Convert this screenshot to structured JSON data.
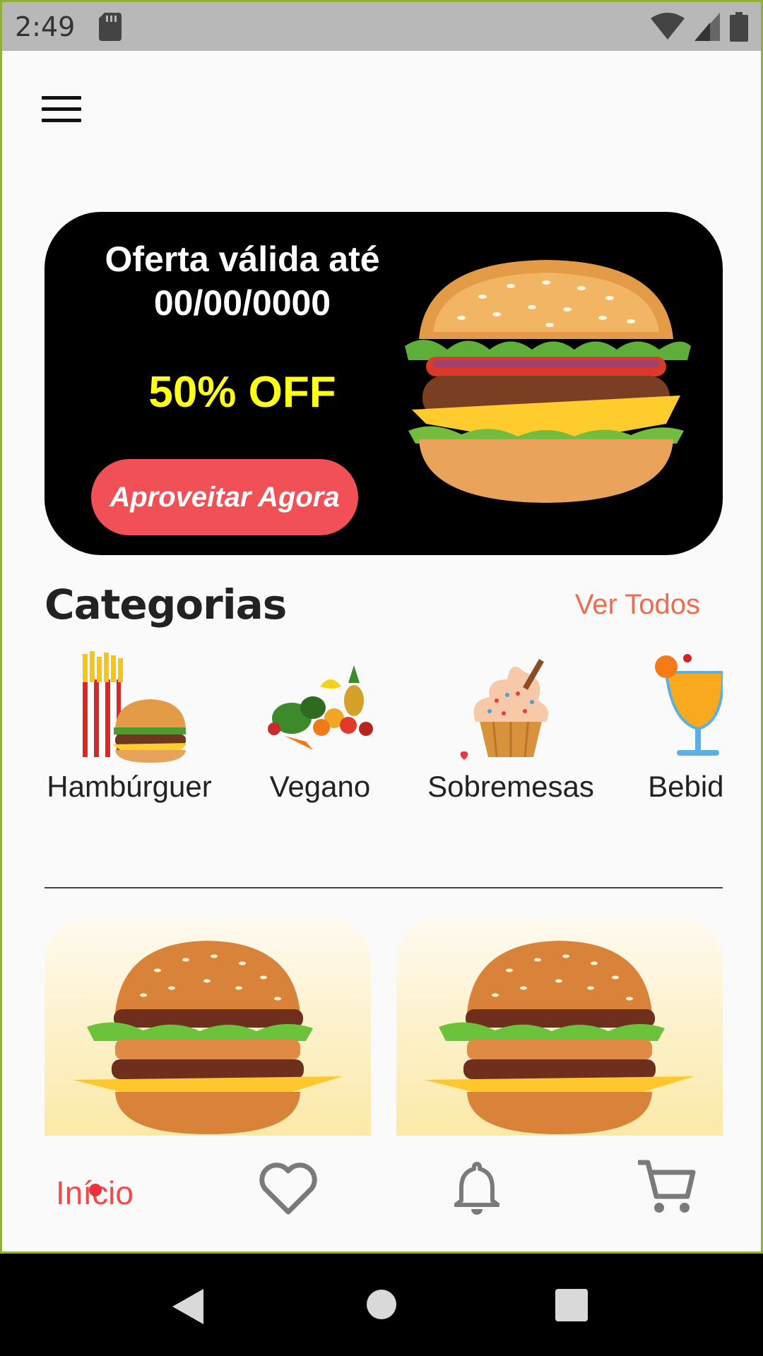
{
  "status_bar": {
    "time": "2:49"
  },
  "promo": {
    "title_line1": "Oferta válida até",
    "title_line2": "00/00/0000",
    "discount": "50% OFF",
    "button_label": "Aproveitar Agora"
  },
  "categories": {
    "title": "Categorias",
    "see_all_label": "Ver Todos",
    "items": [
      {
        "label": "Hambúrguer",
        "icon": "burger-fries-icon"
      },
      {
        "label": "Vegano",
        "icon": "vegetables-icon"
      },
      {
        "label": "Sobremesas",
        "icon": "cupcake-icon"
      },
      {
        "label": "Bebidas",
        "icon": "cocktail-icon"
      }
    ]
  },
  "bottom_nav": {
    "home_label": "Início",
    "items": [
      "home",
      "favorites-heart-icon",
      "notifications-bell-icon",
      "cart-icon"
    ]
  },
  "colors": {
    "accent": "#f15156",
    "promo_discount": "#ffff1a",
    "see_all": "#f26b50",
    "nav_active": "#f14a4a"
  }
}
